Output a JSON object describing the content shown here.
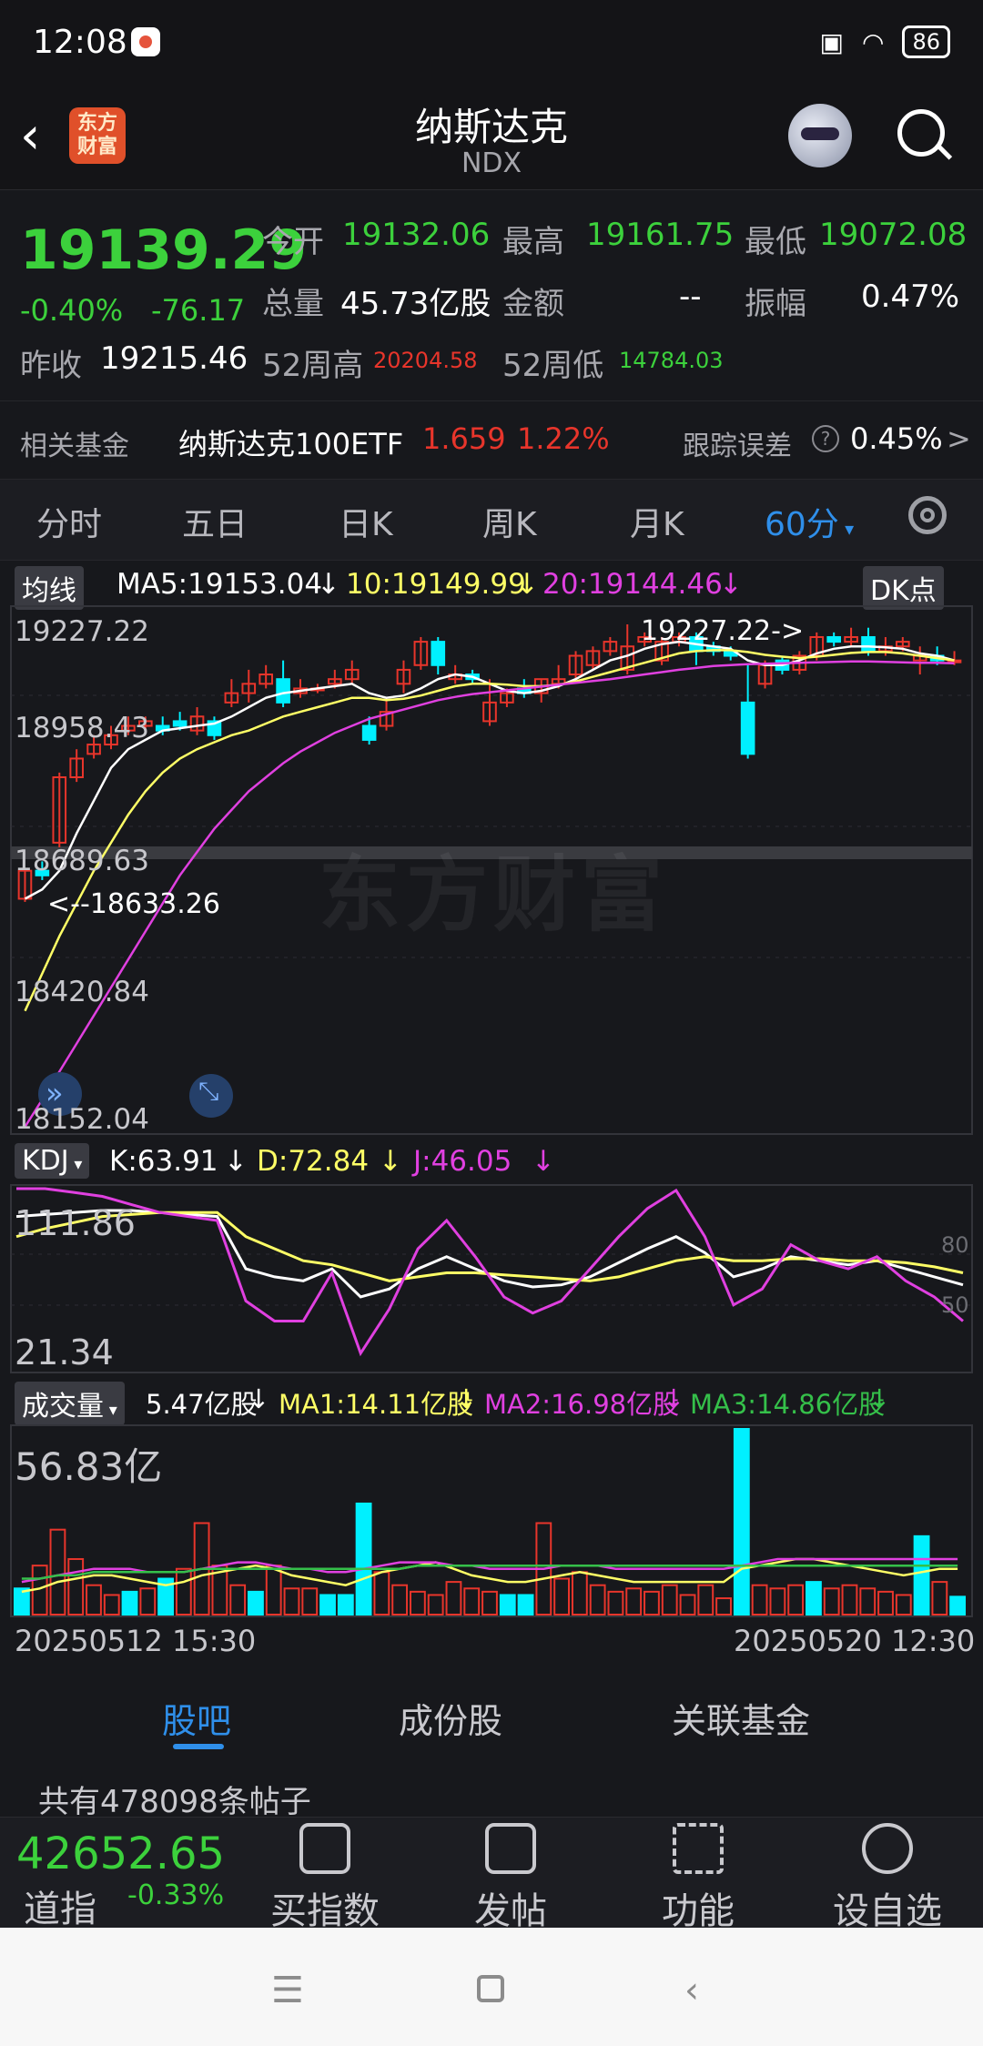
{
  "status": {
    "time": "12:08",
    "battery": "86"
  },
  "header": {
    "title": "纳斯达克",
    "subtitle": "NDX",
    "logo_text": "东方财富"
  },
  "quote": {
    "price": "19139.29",
    "pct": "-0.40%",
    "change": "-76.17",
    "open_label": "今开",
    "open": "19132.06",
    "high_label": "最高",
    "high": "19161.75",
    "low_label": "最低",
    "low": "19072.08",
    "volume_label": "总量",
    "volume": "45.73亿股",
    "amount_label": "金额",
    "amount": "--",
    "amplitude_label": "振幅",
    "amplitude": "0.47%",
    "prev_close_label": "昨收",
    "prev_close": "19215.46",
    "wk52_high_label": "52周高",
    "wk52_high": "20204.58",
    "wk52_low_label": "52周低",
    "wk52_low": "14784.03"
  },
  "fund": {
    "label": "相关基金",
    "name": "纳斯达克100ETF",
    "price": "1.659",
    "pct": "1.22%",
    "tracking_label": "跟踪误差",
    "tracking_value": "0.45%",
    "arrow": ">"
  },
  "tabs": [
    "分时",
    "五日",
    "日K",
    "周K",
    "月K",
    "60分"
  ],
  "main_chart": {
    "chip": "均线",
    "dk_label": "DK点",
    "legend": {
      "ma5": "MA5:19153.04",
      "ma10": "10:19149.99",
      "ma20": "20:19144.46",
      "arrow": "↓"
    },
    "axis": [
      "19227.22",
      "18958.43",
      "18689.63",
      "18420.84",
      "18152.04"
    ],
    "max_label": "19227.22->",
    "min_label": "<--18633.26",
    "watermark": "东方财富"
  },
  "kdj": {
    "chip": "KDJ",
    "k": "K:63.91",
    "d": "D:72.84",
    "j": "J:46.05",
    "arrow": "↓",
    "axis_top": "111.86",
    "axis_bottom": "21.34",
    "level_80": "80",
    "level_50": "50"
  },
  "volume": {
    "chip": "成交量",
    "current": "5.47亿股",
    "ma1": "MA1:14.11亿股",
    "ma2": "MA2:16.98亿股",
    "ma3": "MA3:14.86亿股",
    "arrow": "↓",
    "axis_top": "56.83亿",
    "date_start": "20250512 15:30",
    "date_end": "20250520 12:30"
  },
  "chart_data": [
    {
      "type": "candlestick",
      "title": "纳斯达克 NDX 60分",
      "ylim": [
        18152.04,
        19227.22
      ],
      "candles": [
        {
          "o": 18640,
          "c": 18700,
          "h": 18705,
          "l": 18633.26
        },
        {
          "o": 18700,
          "c": 18690,
          "h": 18720,
          "l": 18680
        },
        {
          "o": 18760,
          "c": 18900,
          "h": 18910,
          "l": 18750
        },
        {
          "o": 18900,
          "c": 18940,
          "h": 18960,
          "l": 18890
        },
        {
          "o": 18950,
          "c": 18970,
          "h": 18990,
          "l": 18940
        },
        {
          "o": 18970,
          "c": 18990,
          "h": 19010,
          "l": 18960
        },
        {
          "o": 19000,
          "c": 19010,
          "h": 19030,
          "l": 18990
        },
        {
          "o": 19010,
          "c": 19020,
          "h": 19030,
          "l": 19000
        },
        {
          "o": 19010,
          "c": 19000,
          "h": 19030,
          "l": 18990
        },
        {
          "o": 19020,
          "c": 19010,
          "h": 19040,
          "l": 19000
        },
        {
          "o": 19000,
          "c": 19030,
          "h": 19050,
          "l": 18990
        },
        {
          "o": 19020,
          "c": 18990,
          "h": 19030,
          "l": 18980
        },
        {
          "o": 19060,
          "c": 19080,
          "h": 19110,
          "l": 19050
        },
        {
          "o": 19080,
          "c": 19100,
          "h": 19130,
          "l": 19060
        },
        {
          "o": 19100,
          "c": 19120,
          "h": 19140,
          "l": 19090
        },
        {
          "o": 19110,
          "c": 19060,
          "h": 19150,
          "l": 19050
        },
        {
          "o": 19080,
          "c": 19090,
          "h": 19110,
          "l": 19070
        },
        {
          "o": 19090,
          "c": 19090,
          "h": 19100,
          "l": 19080
        },
        {
          "o": 19100,
          "c": 19110,
          "h": 19130,
          "l": 19090
        },
        {
          "o": 19110,
          "c": 19130,
          "h": 19150,
          "l": 19100
        },
        {
          "o": 19010,
          "c": 18980,
          "h": 19030,
          "l": 18970
        },
        {
          "o": 19010,
          "c": 19040,
          "h": 19070,
          "l": 19000
        },
        {
          "o": 19100,
          "c": 19130,
          "h": 19150,
          "l": 19080
        },
        {
          "o": 19140,
          "c": 19190,
          "h": 19200,
          "l": 19130
        },
        {
          "o": 19190,
          "c": 19140,
          "h": 19200,
          "l": 19120
        },
        {
          "o": 19110,
          "c": 19120,
          "h": 19140,
          "l": 19100
        },
        {
          "o": 19120,
          "c": 19110,
          "h": 19130,
          "l": 19100
        },
        {
          "o": 19020,
          "c": 19060,
          "h": 19110,
          "l": 19010
        },
        {
          "o": 19060,
          "c": 19080,
          "h": 19090,
          "l": 19050
        },
        {
          "o": 19090,
          "c": 19080,
          "h": 19110,
          "l": 19070
        },
        {
          "o": 19080,
          "c": 19110,
          "h": 19110,
          "l": 19060
        },
        {
          "o": 19100,
          "c": 19110,
          "h": 19140,
          "l": 19090
        },
        {
          "o": 19120,
          "c": 19160,
          "h": 19170,
          "l": 19110
        },
        {
          "o": 19140,
          "c": 19170,
          "h": 19180,
          "l": 19130
        },
        {
          "o": 19170,
          "c": 19190,
          "h": 19200,
          "l": 19160
        },
        {
          "o": 19130,
          "c": 19180,
          "h": 19227.22,
          "l": 19120
        },
        {
          "o": 19190,
          "c": 19200,
          "h": 19210,
          "l": 19180
        },
        {
          "o": 19150,
          "c": 19190,
          "h": 19200,
          "l": 19140
        },
        {
          "o": 19190,
          "c": 19200,
          "h": 19210,
          "l": 19180
        },
        {
          "o": 19200,
          "c": 19170,
          "h": 19210,
          "l": 19140
        },
        {
          "o": 19180,
          "c": 19170,
          "h": 19190,
          "l": 19160
        },
        {
          "o": 19170,
          "c": 19160,
          "h": 19180,
          "l": 19150
        },
        {
          "o": 19060,
          "c": 18950,
          "h": 19140,
          "l": 18940
        },
        {
          "o": 19100,
          "c": 19140,
          "h": 19150,
          "l": 19090
        },
        {
          "o": 19150,
          "c": 19130,
          "h": 19160,
          "l": 19120
        },
        {
          "o": 19130,
          "c": 19160,
          "h": 19170,
          "l": 19120
        },
        {
          "o": 19160,
          "c": 19200,
          "h": 19210,
          "l": 19150
        },
        {
          "o": 19200,
          "c": 19190,
          "h": 19210,
          "l": 19180
        },
        {
          "o": 19190,
          "c": 19200,
          "h": 19220,
          "l": 19180
        },
        {
          "o": 19200,
          "c": 19170,
          "h": 19220,
          "l": 19160
        },
        {
          "o": 19170,
          "c": 19180,
          "h": 19200,
          "l": 19160
        },
        {
          "o": 19180,
          "c": 19190,
          "h": 19200,
          "l": 19170
        },
        {
          "o": 19150,
          "c": 19160,
          "h": 19180,
          "l": 19120
        },
        {
          "o": 19160,
          "c": 19150,
          "h": 19180,
          "l": 19140
        },
        {
          "o": 19150,
          "c": 19150,
          "h": 19170,
          "l": 19140
        }
      ],
      "series": [
        {
          "name": "MA5",
          "color": "#ffffff",
          "values": [
            18640,
            18660,
            18700,
            18780,
            18850,
            18920,
            18960,
            18980,
            19000,
            19005,
            19010,
            19015,
            19030,
            19050,
            19070,
            19080,
            19085,
            19090,
            19095,
            19100,
            19080,
            19070,
            19075,
            19090,
            19110,
            19120,
            19115,
            19100,
            19085,
            19080,
            19085,
            19095,
            19110,
            19130,
            19150,
            19160,
            19175,
            19185,
            19190,
            19185,
            19180,
            19175,
            19150,
            19140,
            19140,
            19150,
            19165,
            19175,
            19180,
            19180,
            19178,
            19175,
            19165,
            19160,
            19150
          ]
        },
        {
          "name": "MA10",
          "color": "#ffff66",
          "values": [
            18400,
            18480,
            18560,
            18630,
            18700,
            18760,
            18820,
            18870,
            18910,
            18940,
            18960,
            18975,
            18990,
            19000,
            19015,
            19030,
            19040,
            19050,
            19060,
            19070,
            19070,
            19065,
            19068,
            19075,
            19085,
            19095,
            19100,
            19100,
            19098,
            19095,
            19095,
            19098,
            19105,
            19115,
            19125,
            19135,
            19145,
            19155,
            19165,
            19170,
            19172,
            19172,
            19168,
            19162,
            19158,
            19155,
            19158,
            19162,
            19166,
            19168,
            19168,
            19165,
            19160,
            19155,
            19150
          ]
        },
        {
          "name": "MA20",
          "color": "#e040e0",
          "values": [
            18152,
            18210,
            18270,
            18330,
            18390,
            18450,
            18510,
            18570,
            18630,
            18690,
            18740,
            18790,
            18830,
            18870,
            18900,
            18930,
            18955,
            18975,
            18995,
            19010,
            19025,
            19035,
            19045,
            19055,
            19065,
            19072,
            19078,
            19082,
            19086,
            19090,
            19094,
            19098,
            19102,
            19106,
            19110,
            19115,
            19120,
            19125,
            19130,
            19134,
            19138,
            19140,
            19142,
            19143,
            19144,
            19145,
            19146,
            19147,
            19148,
            19148,
            19147,
            19146,
            19145,
            19145,
            19144
          ]
        }
      ]
    },
    {
      "type": "line",
      "title": "KDJ",
      "ylim": [
        21.34,
        111.86
      ],
      "series": [
        {
          "name": "K",
          "color": "#ffffff",
          "values": [
            98,
            99,
            100,
            101,
            101,
            100,
            99,
            98,
            72,
            68,
            66,
            72,
            58,
            62,
            72,
            78,
            72,
            66,
            63,
            64,
            68,
            75,
            82,
            88,
            80,
            68,
            72,
            78,
            76,
            74,
            76,
            72,
            68,
            64
          ]
        },
        {
          "name": "D",
          "color": "#ffff66",
          "values": [
            88,
            92,
            95,
            98,
            99,
            100,
            100,
            100,
            88,
            82,
            76,
            74,
            70,
            66,
            68,
            70,
            70,
            69,
            68,
            67,
            66,
            68,
            72,
            76,
            78,
            76,
            76,
            77,
            77,
            76,
            76,
            75,
            73,
            70
          ]
        },
        {
          "name": "J",
          "color": "#e040e0",
          "values": [
            112,
            112,
            110,
            108,
            104,
            100,
            98,
            96,
            56,
            46,
            46,
            70,
            30,
            52,
            82,
            96,
            78,
            58,
            50,
            56,
            72,
            88,
            102,
            111,
            88,
            54,
            62,
            84,
            76,
            72,
            78,
            66,
            58,
            46
          ]
        }
      ]
    },
    {
      "type": "bar",
      "title": "成交量",
      "ylim": [
        0,
        56.83
      ],
      "unit": "亿股",
      "values": [
        8,
        15,
        26,
        17,
        9,
        6,
        7,
        8,
        11,
        14,
        28,
        15,
        9,
        7,
        15,
        8,
        8,
        6,
        6,
        34,
        13,
        9,
        7,
        6,
        10,
        8,
        7,
        6,
        6,
        28,
        11,
        13,
        9,
        7,
        8,
        7,
        9,
        6,
        9,
        5,
        56.83,
        9,
        8,
        9,
        10,
        8,
        9,
        8,
        7,
        6,
        24,
        10,
        5.47
      ],
      "colors": [
        "cyan",
        "red",
        "red",
        "red",
        "red",
        "red",
        "cyan",
        "red",
        "cyan",
        "red",
        "red",
        "red",
        "red",
        "cyan",
        "red",
        "red",
        "red",
        "cyan",
        "cyan",
        "cyan",
        "red",
        "red",
        "red",
        "red",
        "red",
        "red",
        "red",
        "cyan",
        "cyan",
        "red",
        "red",
        "red",
        "red",
        "red",
        "red",
        "red",
        "red",
        "red",
        "red",
        "red",
        "cyan",
        "red",
        "red",
        "red",
        "cyan",
        "red",
        "red",
        "red",
        "red",
        "red",
        "cyan",
        "red",
        "cyan"
      ],
      "series": [
        {
          "name": "MA1",
          "color": "#ffff66",
          "values": [
            7,
            8,
            10,
            11,
            12,
            12,
            11,
            10,
            9,
            10,
            12,
            13,
            14,
            15,
            14,
            12,
            11,
            10,
            9,
            11,
            13,
            14,
            15,
            16,
            14,
            12,
            11,
            10,
            10,
            11,
            12,
            13,
            12,
            11,
            10,
            10,
            10,
            10,
            10,
            10,
            14,
            15,
            16,
            17,
            17,
            16,
            15,
            14,
            13,
            12,
            13,
            14,
            14
          ]
        },
        {
          "name": "MA2",
          "color": "#e040e0",
          "values": [
            10,
            11,
            12,
            13,
            14,
            14,
            14,
            13,
            13,
            13,
            14,
            15,
            16,
            16,
            15,
            14,
            14,
            13,
            13,
            14,
            15,
            16,
            16,
            16,
            15,
            15,
            14,
            14,
            14,
            14,
            15,
            15,
            15,
            14,
            14,
            14,
            14,
            14,
            14,
            14,
            15,
            16,
            17,
            17,
            17,
            17,
            17,
            17,
            17,
            17,
            17,
            17,
            17
          ]
        },
        {
          "name": "MA3",
          "color": "#35c04a",
          "values": [
            11,
            11,
            12,
            12,
            13,
            13,
            13,
            13,
            13,
            13,
            14,
            14,
            14,
            14,
            14,
            14,
            14,
            14,
            14,
            14,
            14,
            14,
            15,
            15,
            15,
            15,
            15,
            15,
            15,
            15,
            15,
            15,
            15,
            15,
            15,
            15,
            15,
            15,
            15,
            15,
            15,
            15,
            15,
            15,
            15,
            15,
            15,
            15,
            15,
            15,
            15,
            15,
            15
          ]
        }
      ]
    }
  ],
  "bottom_tabs": [
    "股吧",
    "成份股",
    "关联基金"
  ],
  "posts": {
    "count_text": "共有478098条帖子"
  },
  "bottom_bar": {
    "index_price": "42652.65",
    "index_name": "道指",
    "index_pct": "-0.33%",
    "actions": [
      {
        "label": "买指数",
        "icon": "chart-icon"
      },
      {
        "label": "发帖",
        "icon": "edit-icon"
      },
      {
        "label": "功能",
        "icon": "grid-icon"
      },
      {
        "label": "设自选",
        "icon": "more-icon"
      }
    ]
  },
  "colors": {
    "up": "#e8352b",
    "down": "#00f0ff",
    "green_text": "#3cd13c",
    "accent": "#2f8fea"
  }
}
